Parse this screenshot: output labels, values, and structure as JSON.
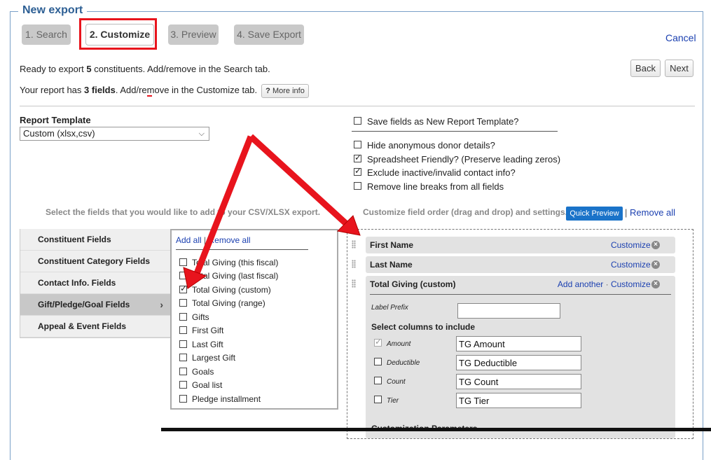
{
  "header": {
    "title": "New export",
    "cancel": "Cancel"
  },
  "steps": [
    "1. Search",
    "2. Customize",
    "3. Preview",
    "4. Save Export"
  ],
  "summary": {
    "line1_pre": "Ready to export ",
    "line1_count": "5",
    "line1_post": " constituents. Add/remove in the Search tab.",
    "line2_pre": "Your report has ",
    "line2_bold": "3 fields",
    "line2_post": ". Add/remove in the Customize tab.",
    "more_info": "More info"
  },
  "nav": {
    "back": "Back",
    "next": "Next"
  },
  "template": {
    "label": "Report Template",
    "selected": "Custom (xlsx,csv)"
  },
  "options": {
    "save_template": "Save fields as New Report Template?",
    "items": [
      {
        "label": "Hide anonymous donor details?",
        "checked": false
      },
      {
        "label": "Spreadsheet Friendly? (Preserve leading zeros)",
        "checked": true
      },
      {
        "label": "Exclude inactive/invalid contact info?",
        "checked": true
      },
      {
        "label": "Remove line breaks from all fields",
        "checked": false
      }
    ]
  },
  "left_hint": "Select the fields that you would like to add to your CSV/XLSX export.",
  "right_hint": "Customize field order (drag and drop) and settings.",
  "quick_preview": "Quick Preview",
  "remove_all": "Remove all",
  "categories": [
    "Constituent Fields",
    "Constituent Category Fields",
    "Contact Info. Fields",
    "Gift/Pledge/Goal Fields",
    "Appeal & Event Fields"
  ],
  "field_list": {
    "add_all": "Add all",
    "remove_all": "Remove all",
    "items": [
      {
        "label": "Total Giving (this fiscal)",
        "checked": false
      },
      {
        "label": "Total Giving (last fiscal)",
        "checked": false
      },
      {
        "label": "Total Giving (custom)",
        "checked": true
      },
      {
        "label": "Total Giving (range)",
        "checked": false
      },
      {
        "label": "Gifts",
        "checked": false
      },
      {
        "label": "First Gift",
        "checked": false
      },
      {
        "label": "Last Gift",
        "checked": false
      },
      {
        "label": "Largest Gift",
        "checked": false
      },
      {
        "label": "Goals",
        "checked": false
      },
      {
        "label": "Goal list",
        "checked": false
      },
      {
        "label": "Pledge installment",
        "checked": false
      }
    ]
  },
  "selected_fields": {
    "rows": [
      {
        "name": "First Name",
        "customize": "Customize"
      },
      {
        "name": "Last Name",
        "customize": "Customize"
      },
      {
        "name": "Total Giving (custom)",
        "add_another": "Add another",
        "customize": "Customize"
      }
    ],
    "label_prefix": "Label Prefix",
    "select_columns": "Select columns to include",
    "columns": [
      {
        "label": "Amount",
        "value": "TG Amount"
      },
      {
        "label": "Deductible",
        "value": "TG Deductible"
      },
      {
        "label": "Count",
        "value": "TG Count"
      },
      {
        "label": "Tier",
        "value": "TG Tier"
      }
    ],
    "params_title": "Customization Parameters"
  },
  "colors": {
    "accent": "#2d5f94",
    "annotation": "#e8141d",
    "link": "#1a3fb0",
    "button_blue": "#1a73c9"
  }
}
